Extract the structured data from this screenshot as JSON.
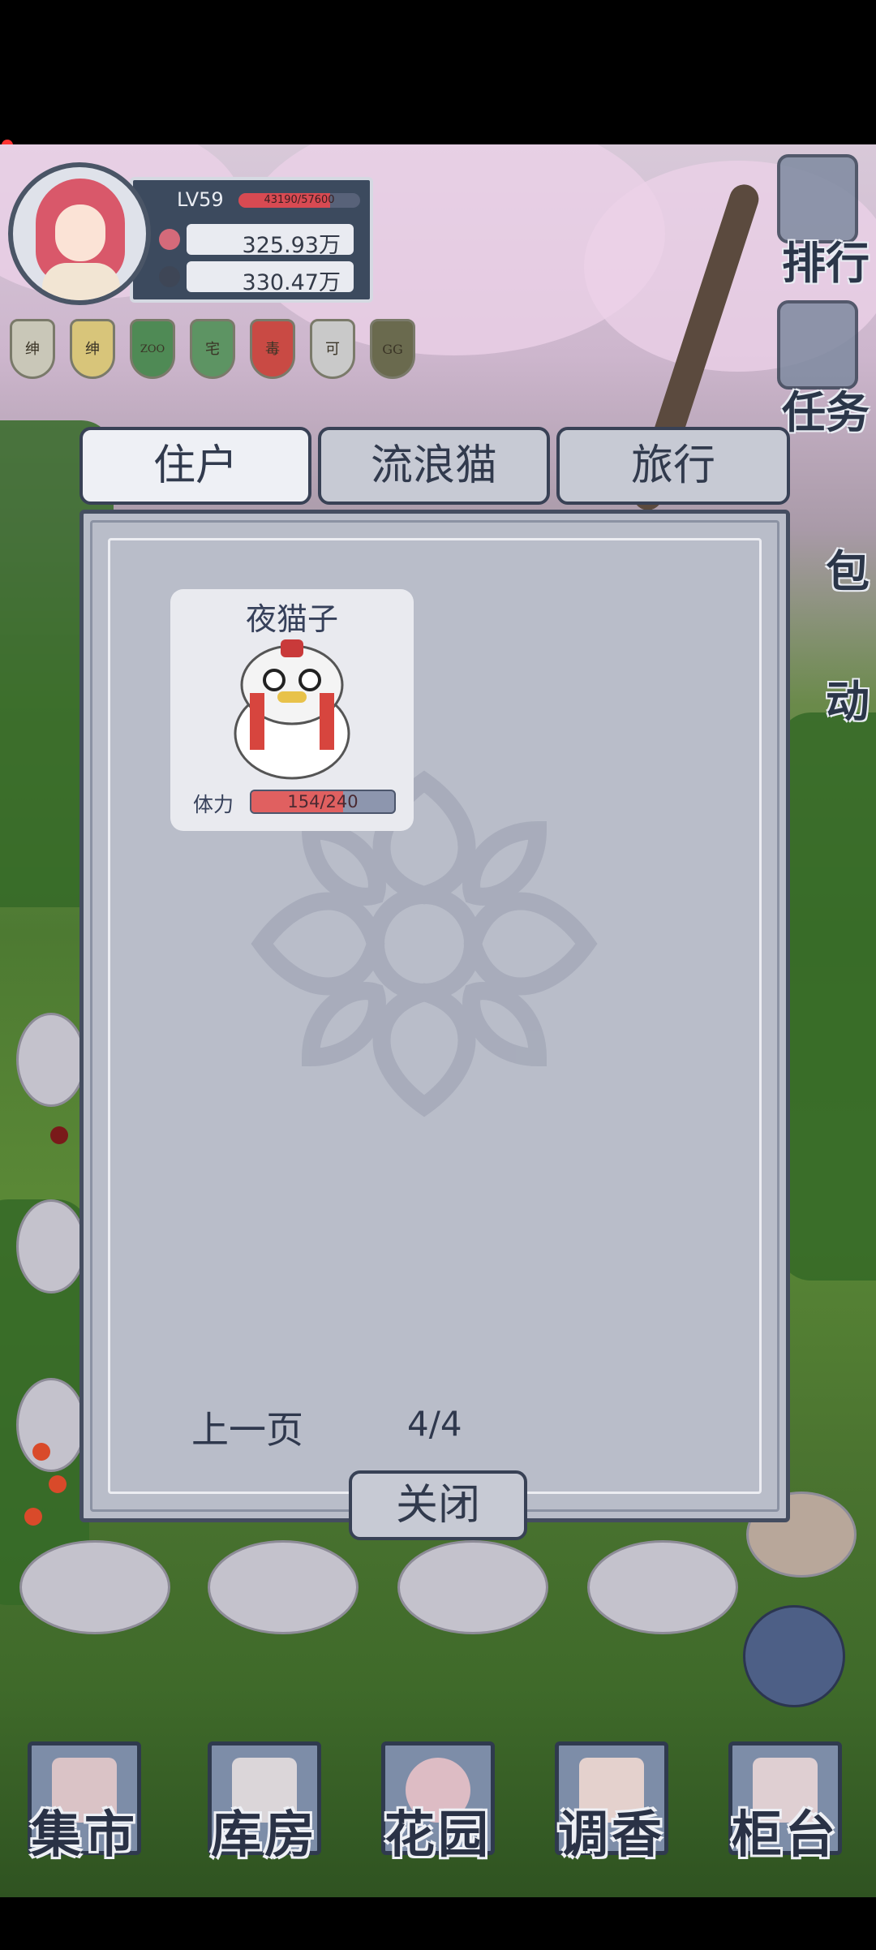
{
  "player": {
    "level": "LV59",
    "exp_text": "43190/57600",
    "exp_fraction": 0.75,
    "resource_1": "325.93万",
    "resource_2": "330.47万"
  },
  "badges": [
    {
      "label": "绅",
      "color": "#c9c7b8"
    },
    {
      "label": "绅",
      "color": "#d8c57a"
    },
    {
      "label": "ZOO",
      "color": "#4f8a55"
    },
    {
      "label": "宅",
      "color": "#5d9463"
    },
    {
      "label": "毒",
      "color": "#c94a44"
    },
    {
      "label": "可",
      "color": "#c9c9c9"
    },
    {
      "label": "GG",
      "color": "#6a6a4e"
    }
  ],
  "side_menu": {
    "rank": "排行",
    "task": "任务",
    "bag": "包",
    "event": "动"
  },
  "tabs": {
    "residents": "住户",
    "strays": "流浪猫",
    "travel": "旅行"
  },
  "cat_card": {
    "name": "夜猫子",
    "hp_label": "体力",
    "hp_text": "154/240",
    "hp_fraction": 0.64
  },
  "pagination": {
    "prev": "上一页",
    "page": "4/4"
  },
  "close_label": "关闭",
  "bottom_nav": {
    "market": "集市",
    "warehouse": "库房",
    "garden": "花园",
    "perfume": "调香",
    "counter": "柜台"
  }
}
